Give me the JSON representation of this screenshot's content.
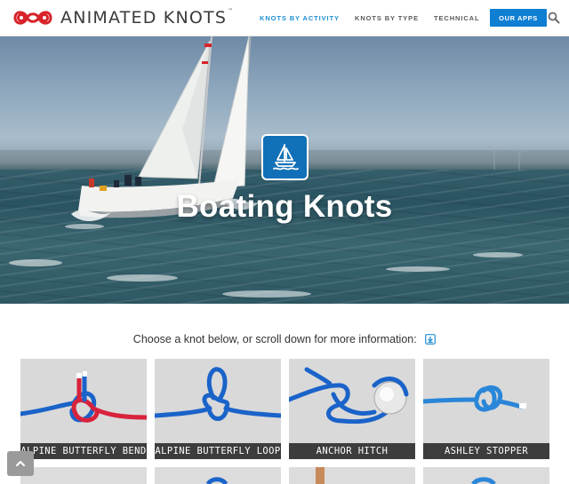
{
  "brand": {
    "name": "ANIMATED KNOTS",
    "tm": "™",
    "colors": {
      "logo_red": "#d8232a",
      "text": "#3a3a3a"
    }
  },
  "nav": {
    "items": [
      {
        "label": "KNOTS BY ACTIVITY",
        "active": true
      },
      {
        "label": "KNOTS BY TYPE",
        "active": false
      },
      {
        "label": "TECHNICAL",
        "active": false
      }
    ],
    "apps_button": "OUR APPS",
    "search_icon": "search-icon",
    "colors": {
      "active": "#1e8fd1",
      "button": "#0f7fd3"
    }
  },
  "hero": {
    "title": "Boating Knots",
    "badge_icon": "sailboat-icon",
    "badge_color": "#1170b8"
  },
  "intro": {
    "text": "Choose a knot below, or scroll down for more information:",
    "icon": "scroll-down-icon",
    "icon_color": "#1e8fd1"
  },
  "knots": [
    {
      "label": "ALPINE BUTTERFLY BEND"
    },
    {
      "label": "ALPINE BUTTERFLY LOOP"
    },
    {
      "label": "ANCHOR HITCH"
    },
    {
      "label": "ASHLEY STOPPER"
    }
  ],
  "back_to_top_icon": "chevron-up-icon"
}
